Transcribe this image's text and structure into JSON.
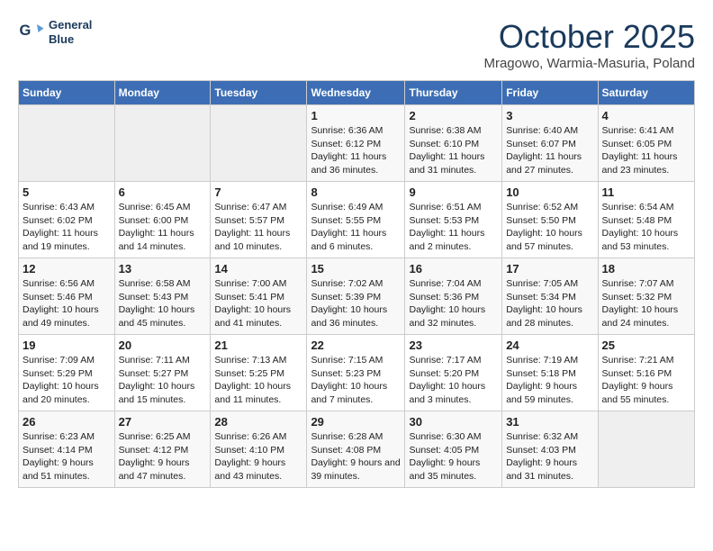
{
  "header": {
    "title": "October 2025",
    "location": "Mragowo, Warmia-Masuria, Poland",
    "logo_line1": "General",
    "logo_line2": "Blue"
  },
  "days_of_week": [
    "Sunday",
    "Monday",
    "Tuesday",
    "Wednesday",
    "Thursday",
    "Friday",
    "Saturday"
  ],
  "weeks": [
    [
      {
        "day": "",
        "info": ""
      },
      {
        "day": "",
        "info": ""
      },
      {
        "day": "",
        "info": ""
      },
      {
        "day": "1",
        "info": "Sunrise: 6:36 AM\nSunset: 6:12 PM\nDaylight: 11 hours and 36 minutes."
      },
      {
        "day": "2",
        "info": "Sunrise: 6:38 AM\nSunset: 6:10 PM\nDaylight: 11 hours and 31 minutes."
      },
      {
        "day": "3",
        "info": "Sunrise: 6:40 AM\nSunset: 6:07 PM\nDaylight: 11 hours and 27 minutes."
      },
      {
        "day": "4",
        "info": "Sunrise: 6:41 AM\nSunset: 6:05 PM\nDaylight: 11 hours and 23 minutes."
      }
    ],
    [
      {
        "day": "5",
        "info": "Sunrise: 6:43 AM\nSunset: 6:02 PM\nDaylight: 11 hours and 19 minutes."
      },
      {
        "day": "6",
        "info": "Sunrise: 6:45 AM\nSunset: 6:00 PM\nDaylight: 11 hours and 14 minutes."
      },
      {
        "day": "7",
        "info": "Sunrise: 6:47 AM\nSunset: 5:57 PM\nDaylight: 11 hours and 10 minutes."
      },
      {
        "day": "8",
        "info": "Sunrise: 6:49 AM\nSunset: 5:55 PM\nDaylight: 11 hours and 6 minutes."
      },
      {
        "day": "9",
        "info": "Sunrise: 6:51 AM\nSunset: 5:53 PM\nDaylight: 11 hours and 2 minutes."
      },
      {
        "day": "10",
        "info": "Sunrise: 6:52 AM\nSunset: 5:50 PM\nDaylight: 10 hours and 57 minutes."
      },
      {
        "day": "11",
        "info": "Sunrise: 6:54 AM\nSunset: 5:48 PM\nDaylight: 10 hours and 53 minutes."
      }
    ],
    [
      {
        "day": "12",
        "info": "Sunrise: 6:56 AM\nSunset: 5:46 PM\nDaylight: 10 hours and 49 minutes."
      },
      {
        "day": "13",
        "info": "Sunrise: 6:58 AM\nSunset: 5:43 PM\nDaylight: 10 hours and 45 minutes."
      },
      {
        "day": "14",
        "info": "Sunrise: 7:00 AM\nSunset: 5:41 PM\nDaylight: 10 hours and 41 minutes."
      },
      {
        "day": "15",
        "info": "Sunrise: 7:02 AM\nSunset: 5:39 PM\nDaylight: 10 hours and 36 minutes."
      },
      {
        "day": "16",
        "info": "Sunrise: 7:04 AM\nSunset: 5:36 PM\nDaylight: 10 hours and 32 minutes."
      },
      {
        "day": "17",
        "info": "Sunrise: 7:05 AM\nSunset: 5:34 PM\nDaylight: 10 hours and 28 minutes."
      },
      {
        "day": "18",
        "info": "Sunrise: 7:07 AM\nSunset: 5:32 PM\nDaylight: 10 hours and 24 minutes."
      }
    ],
    [
      {
        "day": "19",
        "info": "Sunrise: 7:09 AM\nSunset: 5:29 PM\nDaylight: 10 hours and 20 minutes."
      },
      {
        "day": "20",
        "info": "Sunrise: 7:11 AM\nSunset: 5:27 PM\nDaylight: 10 hours and 15 minutes."
      },
      {
        "day": "21",
        "info": "Sunrise: 7:13 AM\nSunset: 5:25 PM\nDaylight: 10 hours and 11 minutes."
      },
      {
        "day": "22",
        "info": "Sunrise: 7:15 AM\nSunset: 5:23 PM\nDaylight: 10 hours and 7 minutes."
      },
      {
        "day": "23",
        "info": "Sunrise: 7:17 AM\nSunset: 5:20 PM\nDaylight: 10 hours and 3 minutes."
      },
      {
        "day": "24",
        "info": "Sunrise: 7:19 AM\nSunset: 5:18 PM\nDaylight: 9 hours and 59 minutes."
      },
      {
        "day": "25",
        "info": "Sunrise: 7:21 AM\nSunset: 5:16 PM\nDaylight: 9 hours and 55 minutes."
      }
    ],
    [
      {
        "day": "26",
        "info": "Sunrise: 6:23 AM\nSunset: 4:14 PM\nDaylight: 9 hours and 51 minutes."
      },
      {
        "day": "27",
        "info": "Sunrise: 6:25 AM\nSunset: 4:12 PM\nDaylight: 9 hours and 47 minutes."
      },
      {
        "day": "28",
        "info": "Sunrise: 6:26 AM\nSunset: 4:10 PM\nDaylight: 9 hours and 43 minutes."
      },
      {
        "day": "29",
        "info": "Sunrise: 6:28 AM\nSunset: 4:08 PM\nDaylight: 9 hours and 39 minutes."
      },
      {
        "day": "30",
        "info": "Sunrise: 6:30 AM\nSunset: 4:05 PM\nDaylight: 9 hours and 35 minutes."
      },
      {
        "day": "31",
        "info": "Sunrise: 6:32 AM\nSunset: 4:03 PM\nDaylight: 9 hours and 31 minutes."
      },
      {
        "day": "",
        "info": ""
      }
    ]
  ]
}
